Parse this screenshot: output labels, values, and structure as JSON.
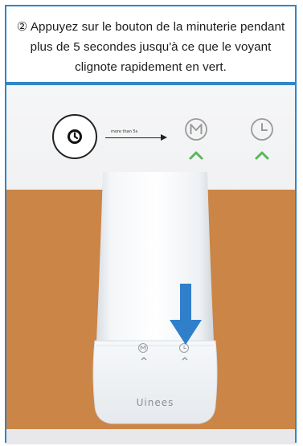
{
  "instruction": {
    "text": "② Appuyez sur le bouton de la minuterie pendant plus de 5 secondes jusqu'à ce que le voyant clignote rapidement en vert."
  },
  "illustration": {
    "hint_text": "more than 5s",
    "brand_logo": "Uinees",
    "colors": {
      "frame": "#2f86c9",
      "arrow": "#2f7fca",
      "indicator": "#57b85a",
      "background_wood": "#cb8546"
    },
    "icons": {
      "timer_button": "clock-icon",
      "mode_button": "m-mode-icon",
      "timer_indicator": "clock-icon",
      "arrows": "chevron-up-icon",
      "press_arrow": "down-arrow-icon"
    }
  }
}
